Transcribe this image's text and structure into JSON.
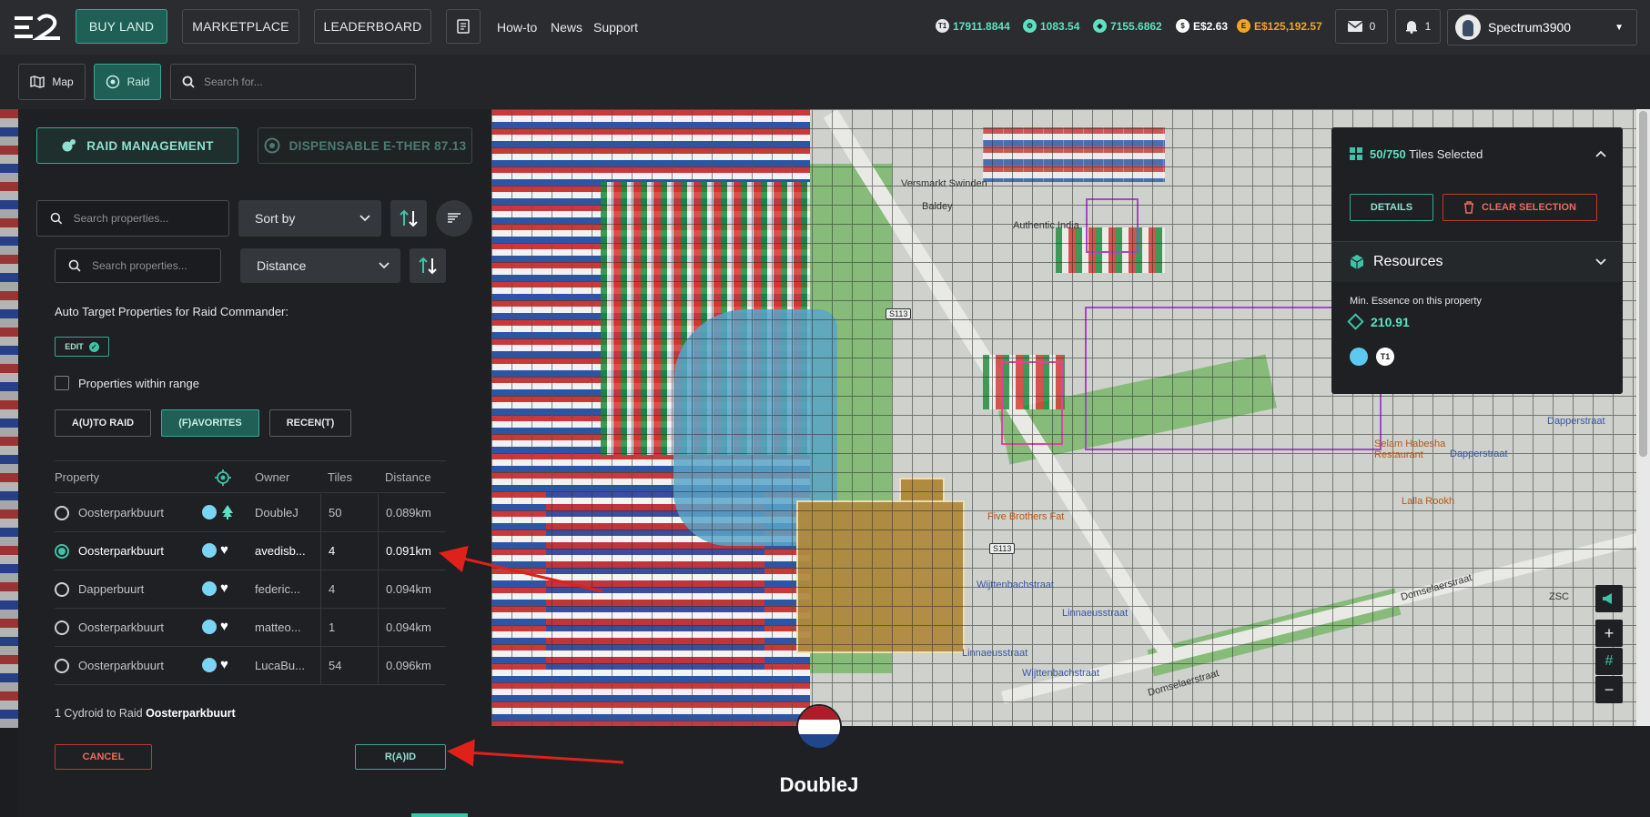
{
  "topbar": {
    "nav": {
      "buy_land": "BUY LAND",
      "marketplace": "MARKETPLACE",
      "leaderboard": "LEADERBOARD"
    },
    "links": {
      "howto": "How-to",
      "news": "News",
      "support": "Support"
    },
    "currencies": [
      {
        "value": "17911.8844",
        "color": "#5ee0c2",
        "icon": "t1-token-icon"
      },
      {
        "value": "1083.54",
        "color": "#5ee0c2",
        "icon": "cydroid-icon"
      },
      {
        "value": "7155.6862",
        "color": "#5ee0c2",
        "icon": "essence-icon"
      },
      {
        "value": "E$2.63",
        "color": "#ffffff",
        "icon": "dollar-icon"
      },
      {
        "value": "E$125,192.57",
        "color": "#f0a52a",
        "icon": "gold-coin-icon"
      }
    ],
    "mail_count": "0",
    "notif_count": "1",
    "username": "Spectrum3900"
  },
  "subbar": {
    "map_label": "Map",
    "raid_label": "Raid",
    "search_placeholder": "Search for..."
  },
  "panel": {
    "tab_raid": "RAID MANAGEMENT",
    "tab_ether": "DISPENSABLE E-THER 87.13",
    "search_placeholder": "Search properties...",
    "sort_label": "Sort by",
    "inner_search_placeholder": "Search properties...",
    "inner_sort": "Distance",
    "auto_target_label": "Auto Target Properties for Raid Commander:",
    "edit_label": "EDIT",
    "within_range_label": "Properties within range",
    "filters": {
      "auto_raid": "A(U)TO RAID",
      "favorites": "(F)AVORITES",
      "recent": "RECEN(T)"
    },
    "table": {
      "headers": {
        "property": "Property",
        "owner": "Owner",
        "tiles": "Tiles",
        "distance": "Distance"
      },
      "rows": [
        {
          "property": "Oosterparkbuurt",
          "owner": "DoubleJ",
          "tiles": "50",
          "distance": "0.089km",
          "badge": "tree-icon",
          "selected": false
        },
        {
          "property": "Oosterparkbuurt",
          "owner": "avedisb...",
          "tiles": "4",
          "distance": "0.091km",
          "badge": "heart-icon",
          "selected": true
        },
        {
          "property": "Dapperbuurt",
          "owner": "federic...",
          "tiles": "4",
          "distance": "0.094km",
          "badge": "heart-icon",
          "selected": false
        },
        {
          "property": "Oosterparkbuurt",
          "owner": "matteo...",
          "tiles": "1",
          "distance": "0.094km",
          "badge": "heart-icon",
          "selected": false
        },
        {
          "property": "Oosterparkbuurt",
          "owner": "LucaBu...",
          "tiles": "54",
          "distance": "0.096km",
          "badge": "heart-icon",
          "selected": false
        }
      ]
    },
    "footnote_prefix": "1 Cydroid to Raid",
    "footnote_target": "Oosterparkbuurt",
    "cancel_label": "CANCEL",
    "raid_label": "R(A)ID"
  },
  "map": {
    "labels": {
      "versmarkt": "Versmarkt Swinden",
      "baldey": "Baldey",
      "authentic": "Authentic India",
      "s113a": "S113",
      "s113b": "S113",
      "five_brothers": "Five Brothers Fat",
      "wijttenbach1": "Wijttenbachstraat",
      "linnaeus1": "Linnaeusstraat",
      "linnaeus2": "Linnaeusstraat",
      "wijttenbach2": "Wijttenbachstraat",
      "domselaer1": "Domselaerstraat",
      "domselaer2": "Domselaerstraat",
      "dapper1": "Dapperstraat",
      "dapper2": "Dapperstraat",
      "selam": "Selam Habesha Restaurant",
      "lalla": "Lalla Rookh",
      "zsc": "ZSC"
    }
  },
  "popup": {
    "tiles_selected_count": "50/750",
    "tiles_selected_suffix": "Tiles Selected",
    "details_label": "DETAILS",
    "clear_label": "CLEAR SELECTION",
    "resources_title": "Resources",
    "min_essence_label": "Min. Essence on this property",
    "min_essence_value": "210.91",
    "tier_label": "T1"
  },
  "bottom": {
    "owner_name": "DoubleJ"
  },
  "colors": {
    "accent": "#3aa896",
    "danger": "#c0392b",
    "gold": "#f0a52a"
  }
}
